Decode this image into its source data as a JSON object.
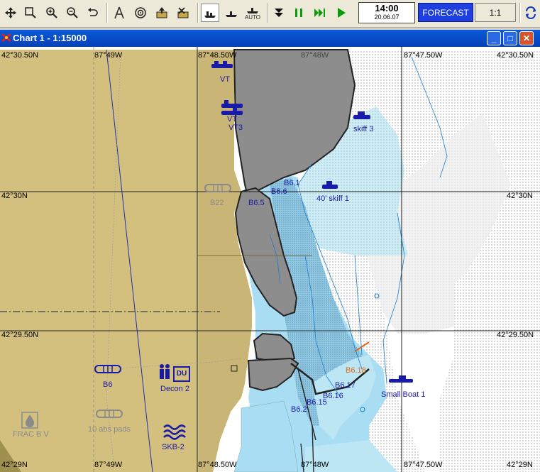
{
  "toolbar": {
    "buttons": [
      "pan-tool",
      "zoom-window",
      "zoom-in",
      "zoom-out",
      "undo-zoom",
      "draw-polygon",
      "target",
      "export",
      "import",
      "vessel-mode",
      "boat-mode",
      "auto-mode",
      "step-back",
      "pause",
      "fast-forward",
      "play",
      "refresh"
    ],
    "auto_label": "AUTO",
    "time": "14:00",
    "date": "20.06.07",
    "forecast_label": "FORECAST",
    "scale_label": "1:1"
  },
  "window": {
    "title": "Chart 1 - 1:15000"
  },
  "map": {
    "lat_labels": {
      "n3050_left": "42°30.50N",
      "n3050_right": "42°30.50N",
      "n30_left": "42°30N",
      "n30_right": "42°30N",
      "n2950_left": "42°29.50N",
      "n2950_right": "42°29.50N",
      "n29_left": "42°29N",
      "n29_right": "42°29N"
    },
    "lon_labels": {
      "w49_top": "87°49W",
      "w4850_top": "87°48.50W",
      "w48_top": "87°48W",
      "w4750_top": "87°47.50W",
      "w49_bottom": "87°49W",
      "w4850_bottom": "87°48.50W",
      "w48_bottom": "87°48W",
      "w4750_bottom": "87°47.50W"
    },
    "features": {
      "vt1": "VT",
      "vt2": "VT",
      "vt3": "VT3",
      "skiff3": "skiff 3",
      "b61": "B6.1",
      "b66": "B6.6",
      "b65": "B6.5",
      "skiff1": "40' skiff 1",
      "b22": "B22",
      "b6": "B6",
      "decon2": "Decon 2",
      "du": "DU",
      "b618": "B6.18",
      "b617": "B6.17",
      "b616": "B6.16",
      "b615": "B6.15",
      "b62": "B6.2",
      "smallboat1": "Small Boat 1",
      "fracbv": "FRAC B V",
      "absPads": "10 abs pads",
      "skb2": "SKB-2"
    }
  },
  "colors": {
    "land": "#d3c07f",
    "deep_water": "#ffffff",
    "shallow": "#a8dcf4",
    "very_shallow": "#bde6f5",
    "dry": "#8d8d8d",
    "forecast_bg": "#1f3fe0",
    "title_bar": "#0a5ad8"
  }
}
